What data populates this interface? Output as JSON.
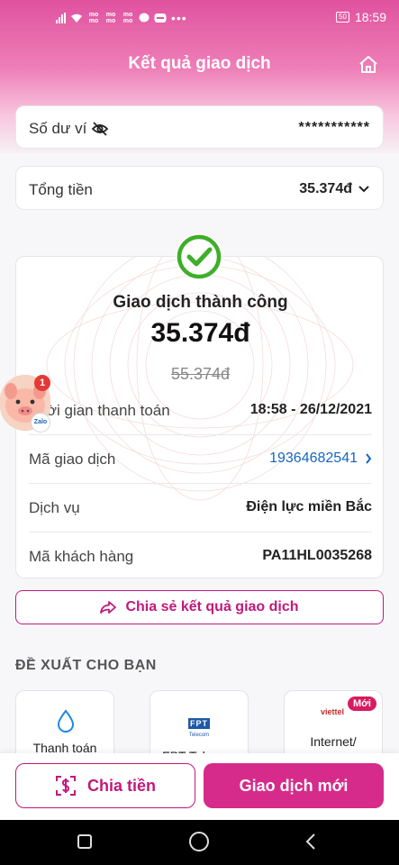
{
  "status_bar": {
    "app_badges": [
      "mo mo",
      "mo mo",
      "mo mo"
    ],
    "more": "•••",
    "battery": "50",
    "time": "18:59"
  },
  "header": {
    "title": "Kết quả giao dịch"
  },
  "balance": {
    "label": "Số dư ví",
    "value": "***********"
  },
  "total": {
    "label": "Tổng tiền",
    "value": "35.374đ"
  },
  "result": {
    "status": "Giao dịch thành công",
    "amount": "35.374đ",
    "original_amount": "55.374đ",
    "rows": [
      {
        "label": "Thời gian thanh toán",
        "value": "18:58 - 26/12/2021"
      },
      {
        "label": "Mã giao dịch",
        "value": "19364682541"
      },
      {
        "label": "Dịch vụ",
        "value": "Điện lực miền Bắc"
      },
      {
        "label": "Mã khách hàng",
        "value": "PA11HL0035268"
      }
    ]
  },
  "share": {
    "label": "Chia sẻ kết quả giao dịch"
  },
  "suggestions": {
    "title": "ĐỀ XUẤT CHO BẠN",
    "items": [
      {
        "label": "Thanh toán",
        "icon": "water-drop-icon"
      },
      {
        "label": "FPT Telecom",
        "icon": "fpt-logo-icon",
        "logo_text": "FPT",
        "logo_sub": "Telecom"
      },
      {
        "label": "Internet/",
        "icon": "viettel-logo-icon",
        "logo_text": "viettel",
        "badge": "Mới"
      }
    ]
  },
  "actions": {
    "split": "Chia tiền",
    "new_transaction": "Giao dịch mới"
  },
  "chat_head": {
    "count": "1",
    "app": "Zalo"
  },
  "colors": {
    "brand": "#d62b8a",
    "brand_dark": "#c0197b",
    "success": "#3fae29",
    "link": "#1565c0"
  }
}
